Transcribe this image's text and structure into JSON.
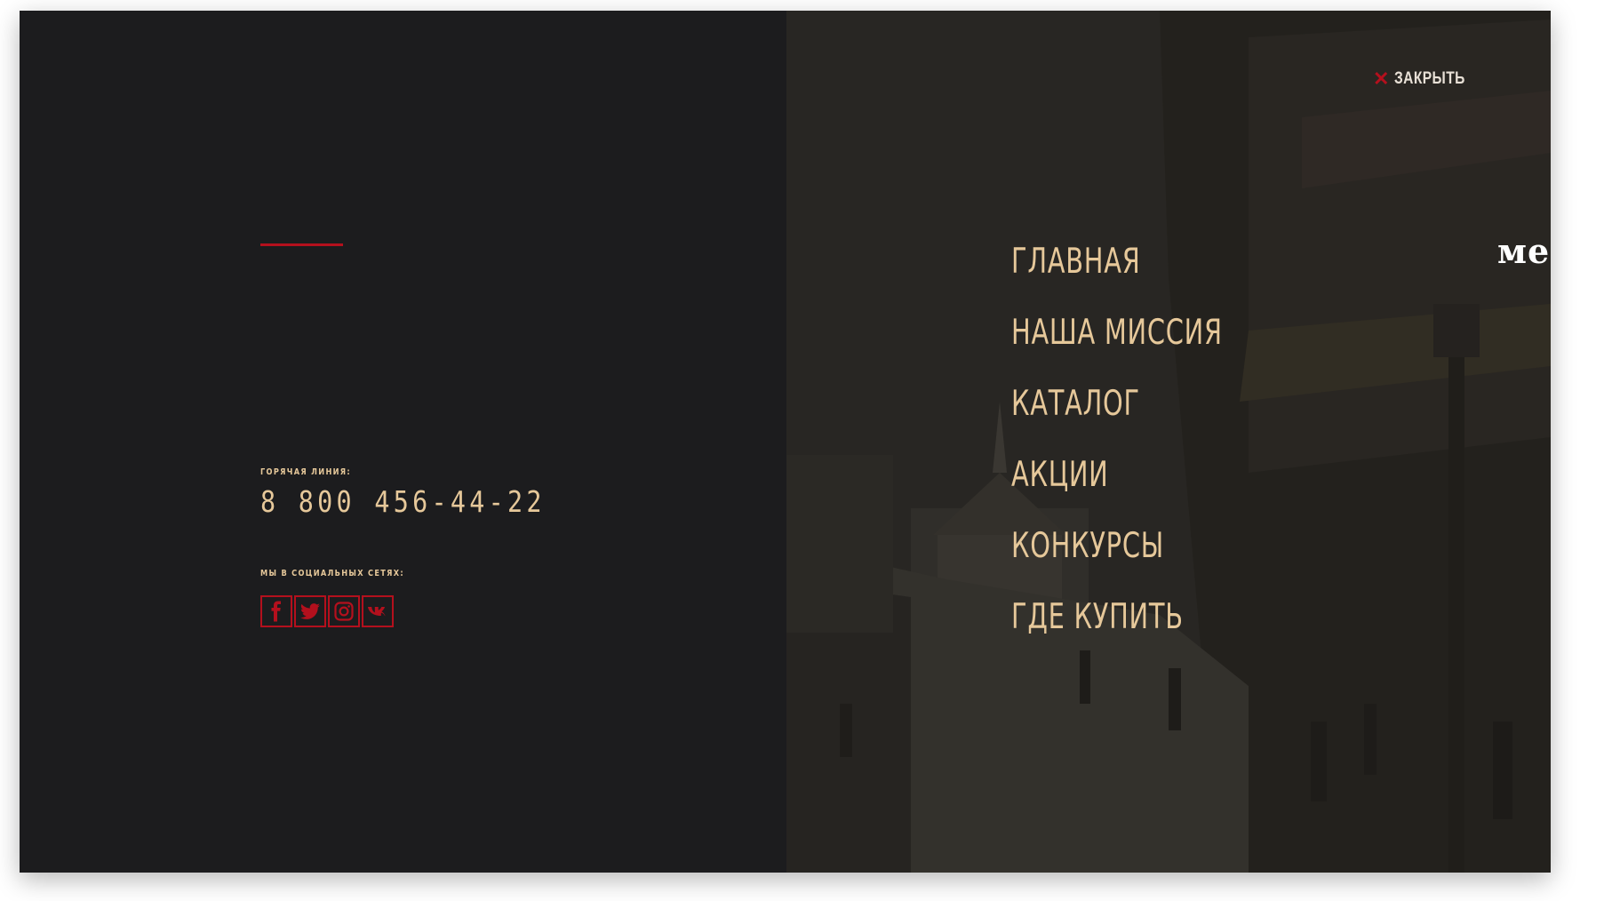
{
  "colors": {
    "accent": "#b4101d",
    "gold": "#e6c89a",
    "dark_bg": "#1c1c1e",
    "light_text": "#e8e0d6"
  },
  "close": {
    "icon": "close-icon",
    "label": "ЗАКРЫТЬ"
  },
  "contacts": {
    "hotline_label": "ГОРЯЧАЯ ЛИНИЯ:",
    "hotline_number": "8 800 456-44-22",
    "social_label": "МЫ В СОЦИАЛЬНЫХ СЕТЯХ:",
    "social": [
      {
        "name": "facebook",
        "icon": "facebook-icon"
      },
      {
        "name": "twitter",
        "icon": "twitter-icon"
      },
      {
        "name": "instagram",
        "icon": "instagram-icon"
      },
      {
        "name": "vk",
        "icon": "vk-icon"
      }
    ]
  },
  "menu": {
    "items": [
      {
        "label": "ГЛАВНАЯ"
      },
      {
        "label": "НАША МИССИЯ"
      },
      {
        "label": "КАТАЛОГ"
      },
      {
        "label": "АКЦИИ"
      },
      {
        "label": "КОНКУРСЫ"
      },
      {
        "label": "ГДЕ КУПИТЬ"
      }
    ]
  },
  "brand": {
    "partial_text": "ме"
  }
}
